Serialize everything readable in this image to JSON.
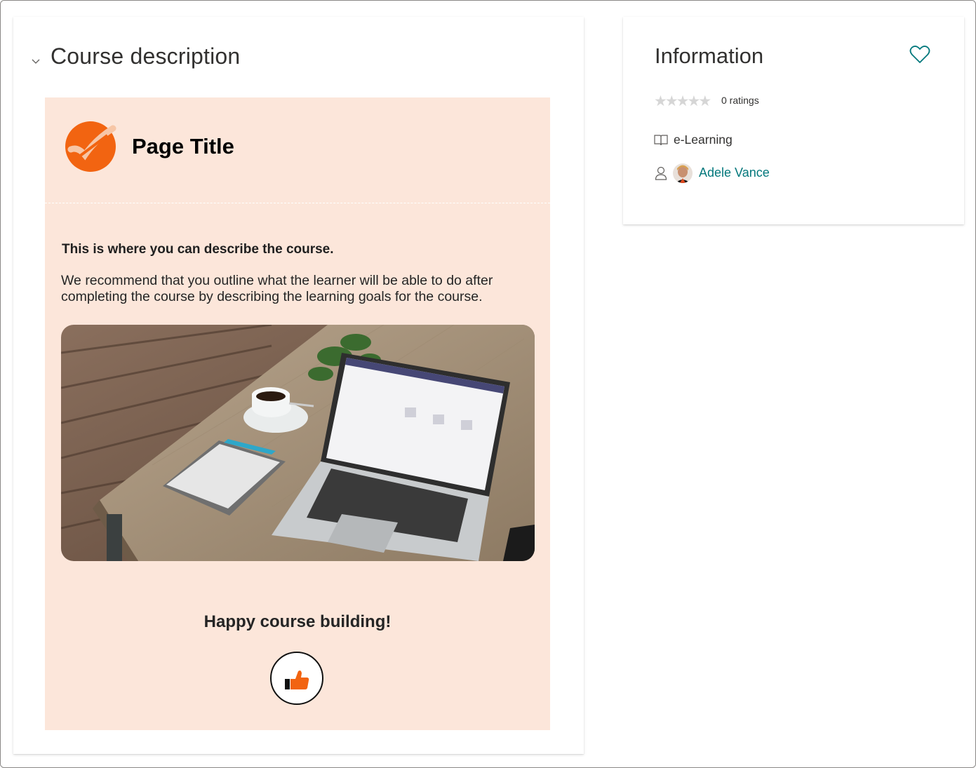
{
  "course": {
    "section_title": "Course description",
    "page_title": "Page Title",
    "lead": "This is where you can describe the course.",
    "body": "We recommend that you outline what the learner will be able to do after completing the course by describing the learning goals for the course.",
    "closing": "Happy course building!",
    "photo_icon": "laptop-desk-photo",
    "logo_icon": "orange-check-logo",
    "thumb_icon": "thumbs-up-icon"
  },
  "info": {
    "title": "Information",
    "ratings_label": "0 ratings",
    "rating": 0,
    "rating_max": 5,
    "type": "e-Learning",
    "author": "Adele Vance"
  },
  "colors": {
    "content_bg": "#fce6da",
    "accent_orange": "#f26411",
    "link_teal": "#03787c"
  }
}
